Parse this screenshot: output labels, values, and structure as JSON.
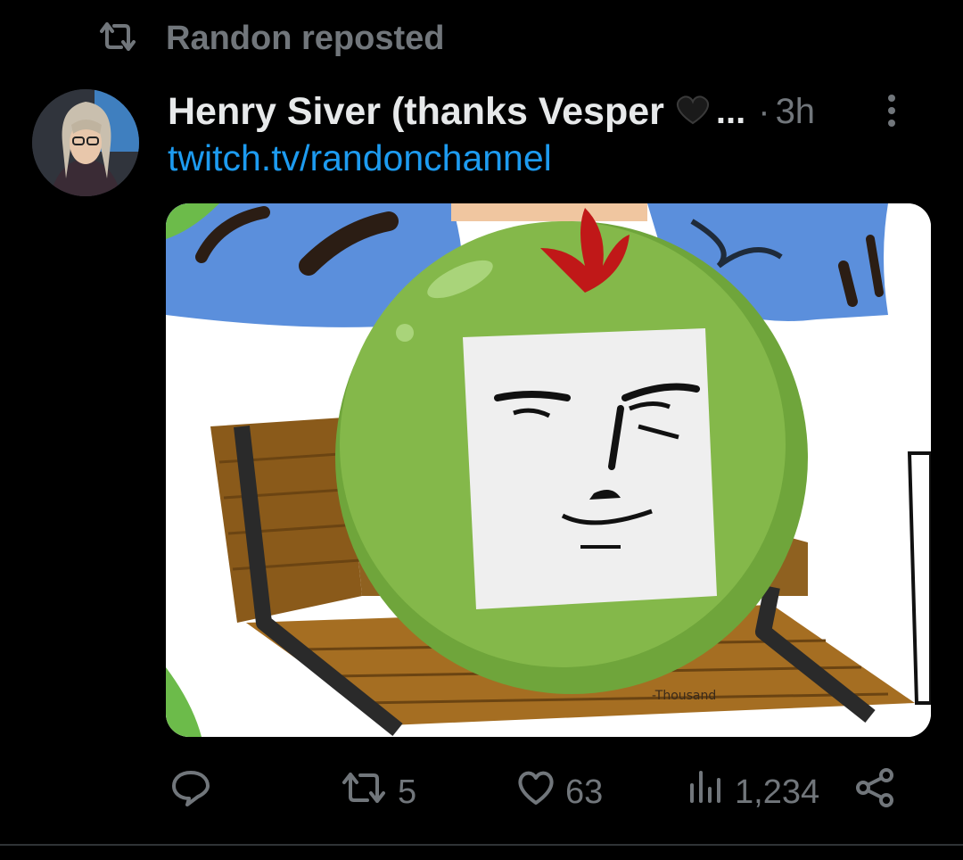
{
  "repost": {
    "label": "Randon reposted",
    "icon": "repost-icon"
  },
  "post": {
    "author_name": "Henry Siver (thanks Vesper",
    "name_emoji": "black-heart",
    "ellipsis": "...",
    "separator": "·",
    "timestamp": "3h",
    "link_text": "twitch.tv/randonchannel",
    "media": {
      "description_icon": "tweet-image",
      "signature": "-Thousand"
    }
  },
  "actions": {
    "reply_count": "",
    "repost_count": "5",
    "like_count": "63",
    "view_count": "1,234"
  },
  "colors": {
    "background": "#000000",
    "text_primary": "#e7e9ea",
    "text_secondary": "#71767b",
    "link": "#1d9bf0"
  }
}
